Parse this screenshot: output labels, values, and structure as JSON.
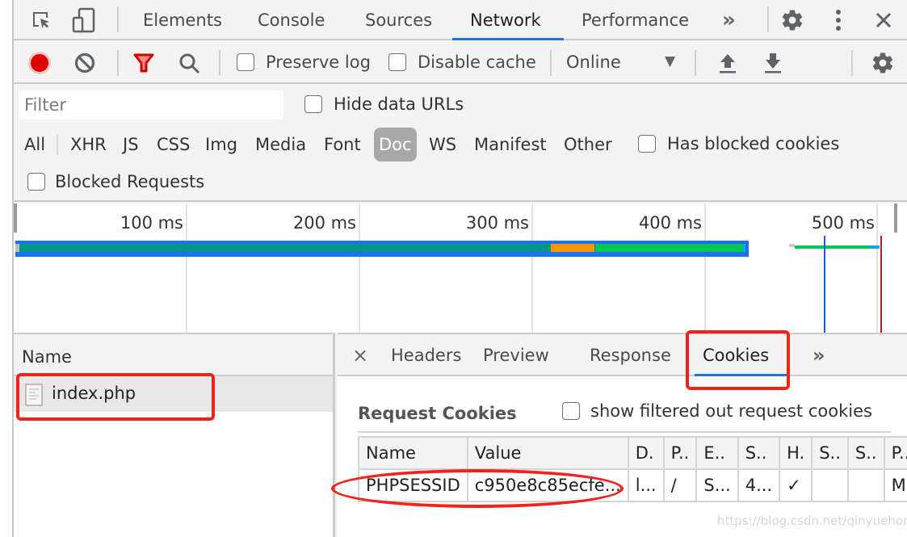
{
  "devtools": {
    "main_tabs": [
      {
        "label": "Elements",
        "active": false
      },
      {
        "label": "Console",
        "active": false
      },
      {
        "label": "Sources",
        "active": false
      },
      {
        "label": "Network",
        "active": true
      },
      {
        "label": "Performance",
        "active": false
      }
    ],
    "more_tabs_glyph": "»",
    "icons": {
      "inspect": "inspect-element-icon",
      "device": "device-toolbar-icon",
      "settings": "gear-icon",
      "menu": "kebab-menu-icon",
      "close": "close-icon"
    },
    "close_glyph": "✕",
    "menu_glyph": "⋮"
  },
  "toolbar": {
    "record_color": "#e00000",
    "preserve_log": {
      "label": "Preserve log",
      "checked": false
    },
    "disable_cache": {
      "label": "Disable cache",
      "checked": false
    },
    "throttling": {
      "selected": "Online",
      "arrow": "▼"
    }
  },
  "filter": {
    "placeholder": "Filter",
    "value": "",
    "hide_data_urls": {
      "label": "Hide data URLs",
      "checked": false
    },
    "types": [
      "All",
      "XHR",
      "JS",
      "CSS",
      "Img",
      "Media",
      "Font",
      "Doc",
      "WS",
      "Manifest",
      "Other"
    ],
    "active_type": "Doc",
    "has_blocked_cookies": {
      "label": "Has blocked cookies",
      "checked": false
    },
    "blocked_requests": {
      "label": "Blocked Requests",
      "checked": false
    }
  },
  "overview": {
    "ticks": [
      "100 ms",
      "200 ms",
      "300 ms",
      "400 ms",
      "500 ms"
    ],
    "colors": {
      "highlight": "#1a73e8",
      "waiting": "#009688",
      "ssl": "#ff9800",
      "download": "#00c853",
      "dom_content_loaded": "#1565c0",
      "load": "#b71c1c"
    }
  },
  "requests": {
    "column_header": "Name",
    "rows": [
      {
        "name": "index.php",
        "selected": true
      }
    ]
  },
  "details": {
    "close_glyph": "×",
    "tabs": [
      {
        "label": "Headers",
        "active": false
      },
      {
        "label": "Preview",
        "active": false
      },
      {
        "label": "Response",
        "active": false
      },
      {
        "label": "Cookies",
        "active": true
      }
    ],
    "more_glyph": "»",
    "section_title": "Request Cookies",
    "show_filtered": {
      "label": "show filtered out request cookies",
      "checked": false
    },
    "cookie_table": {
      "headers": [
        "Name",
        "Value",
        "D.",
        "P..",
        "E..",
        "S..",
        "H.",
        "S..",
        "S..",
        "P.."
      ],
      "rows": [
        [
          "PHPSESSID",
          "c950e8c85ecfe...",
          "l...",
          "/",
          "S...",
          "4...",
          "✓",
          "",
          "",
          "M."
        ]
      ]
    }
  },
  "watermark": "https://blog.csdn.net/qinyuehong"
}
